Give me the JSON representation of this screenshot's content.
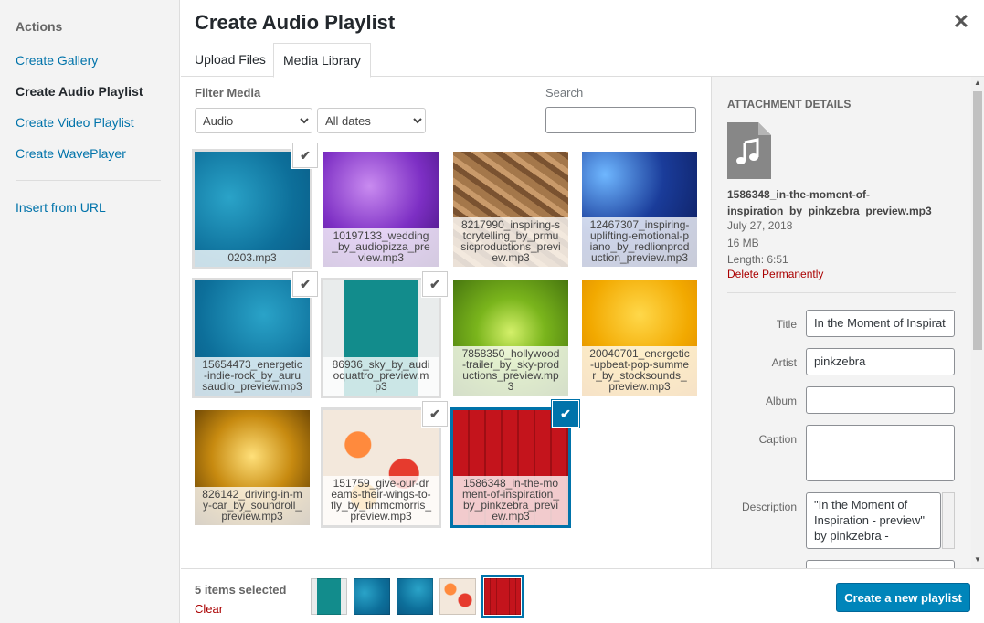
{
  "sidebar": {
    "heading": "Actions",
    "items": [
      {
        "label": "Create Gallery"
      },
      {
        "label": "Create Audio Playlist",
        "active": true
      },
      {
        "label": "Create Video Playlist"
      },
      {
        "label": "Create WavePlayer"
      }
    ],
    "insert_from_url": "Insert from URL"
  },
  "modal": {
    "title": "Create Audio Playlist",
    "tabs": [
      "Upload Files",
      "Media Library"
    ],
    "active_tab": "Media Library"
  },
  "filter": {
    "label": "Filter Media",
    "type_value": "Audio",
    "date_value": "All dates",
    "search_label": "Search",
    "search_value": ""
  },
  "media": [
    {
      "filename": "0203.mp3",
      "selected": true
    },
    {
      "filename": "10197133_wedding_by_audiopizza_preview.mp3",
      "selected": false
    },
    {
      "filename": "8217990_inspiring-storytelling_by_prmusicproductions_preview.mp3",
      "selected": false
    },
    {
      "filename": "12467307_inspiring-uplifting-emotional-piano_by_redlionproduction_preview.mp3",
      "selected": false
    },
    {
      "filename": "15654473_energetic-indie-rock_by_aurusaudio_preview.mp3",
      "selected": true
    },
    {
      "filename": "86936_sky_by_audioquattro_preview.mp3",
      "selected": true
    },
    {
      "filename": "7858350_hollywood-trailer_by_sky-productions_preview.mp3",
      "selected": false
    },
    {
      "filename": "20040701_energetic-upbeat-pop-summer_by_stocksounds_preview.mp3",
      "selected": false
    },
    {
      "filename": "826142_driving-in-my-car_by_soundroll_preview.mp3",
      "selected": false
    },
    {
      "filename": "151759_give-our-dreams-their-wings-to-fly_by_timmcmorris_preview.mp3",
      "selected": true
    },
    {
      "filename": "1586348_in-the-moment-of-inspiration_by_pinkzebra_preview.mp3",
      "selected": true,
      "current": true
    }
  ],
  "details": {
    "header": "ATTACHMENT DETAILS",
    "filename": "1586348_in-the-moment-of-inspiration_by_pinkzebra_preview.mp3",
    "date": "July 27, 2018",
    "size": "16 MB",
    "length": "Length: 6:51",
    "delete_label": "Delete Permanently",
    "fields": {
      "title_label": "Title",
      "title_value": "In the Moment of Inspirat",
      "artist_label": "Artist",
      "artist_value": "pinkzebra",
      "album_label": "Album",
      "album_value": "",
      "caption_label": "Caption",
      "caption_value": "",
      "description_label": "Description",
      "description_value": "\"In the Moment of Inspiration - preview\" by pinkzebra -"
    }
  },
  "toolbar": {
    "selected_count": "5 items selected",
    "clear_label": "Clear",
    "create_label": "Create a new playlist"
  },
  "icons": {
    "close": "close-icon",
    "check": "checkmark-icon",
    "file": "audio-file-icon"
  }
}
